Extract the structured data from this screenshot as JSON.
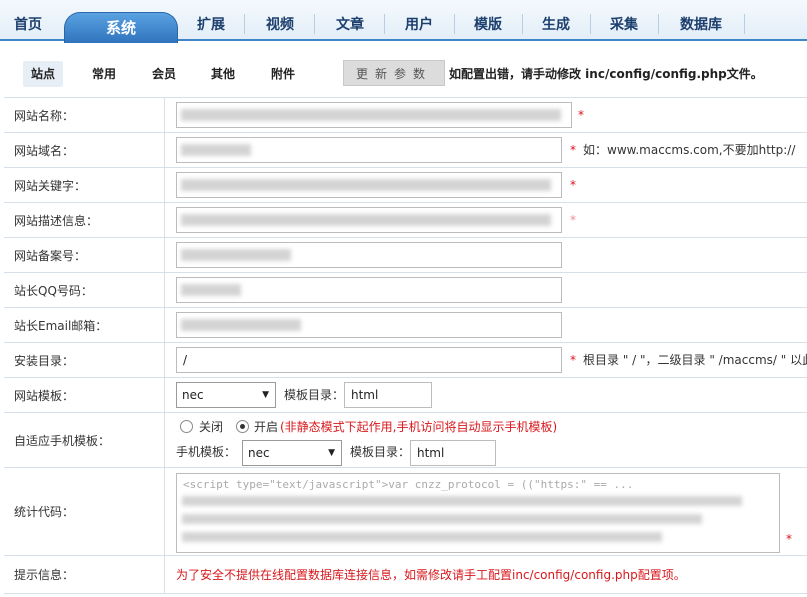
{
  "topnav": {
    "tabs": [
      {
        "label": "首页"
      },
      {
        "label": "系统",
        "active": true
      },
      {
        "label": "扩展"
      },
      {
        "label": "视频"
      },
      {
        "label": "文章"
      },
      {
        "label": "用户"
      },
      {
        "label": "模版"
      },
      {
        "label": "生成"
      },
      {
        "label": "采集"
      },
      {
        "label": "数据库"
      }
    ]
  },
  "subnav": {
    "items": [
      {
        "label": "站点",
        "active": true
      },
      {
        "label": "常用"
      },
      {
        "label": "会员"
      },
      {
        "label": "其他"
      },
      {
        "label": "附件"
      }
    ],
    "update_button": "更新参数",
    "notice": "如配置出错，请手动修改 inc/config/config.php文件。"
  },
  "form": {
    "site_name": {
      "label": "网站名称：",
      "value": "",
      "required": "*"
    },
    "site_domain": {
      "label": "网站域名：",
      "value": "",
      "required": "*",
      "hint": "如：www.maccms.com,不要加http://"
    },
    "site_keywords": {
      "label": "网站关键字：",
      "value": "",
      "required": "*"
    },
    "site_description": {
      "label": "网站描述信息：",
      "value": "",
      "required": "*"
    },
    "icp": {
      "label": "网站备案号：",
      "value": ""
    },
    "qq": {
      "label": "站长QQ号码：",
      "value": ""
    },
    "email": {
      "label": "站长Email邮箱：",
      "value": ""
    },
    "install_dir": {
      "label": "安装目录：",
      "value": "/",
      "required": "*",
      "hint": "根目录 \" / \"，二级目录 \" /maccms/ \" 以此"
    },
    "template": {
      "label": "网站模板：",
      "selected": "nec",
      "dir_label": "模板目录：",
      "dir_value": "html"
    },
    "mobile_template": {
      "label": "自适应手机模板：",
      "off_label": "关闭",
      "on_label": "开启",
      "state": "on",
      "note": "(非静态模式下起作用,手机访问将自动显示手机模板)",
      "tpl_label": "手机模板：",
      "selected": "nec",
      "dir_label": "模板目录：",
      "dir_value": "html"
    },
    "stats_code": {
      "label": "统计代码：",
      "value": "<script type=\"text/javascript\">var cnzz_protocol = ((\"https:\" == ...",
      "required": "*"
    },
    "tip": {
      "label": "提示信息：",
      "text": "为了安全不提供在线配置数据库连接信息，如需修改请手工配置inc/config/config.php配置项。"
    }
  },
  "colors": {
    "accent": "#2f74bd",
    "required": "#d12222",
    "warning": "#d8181c"
  },
  "icons": {
    "select_arrow": "triangle-down-icon"
  }
}
